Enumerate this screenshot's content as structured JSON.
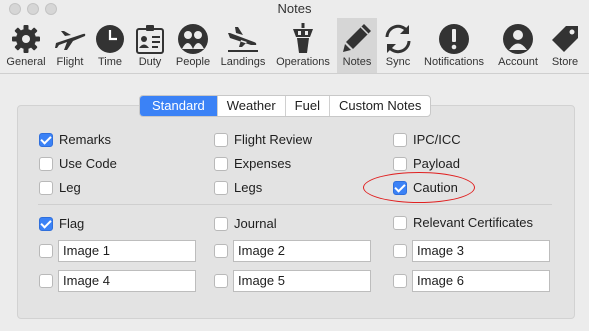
{
  "window": {
    "title": "Notes"
  },
  "toolbar": {
    "items": [
      {
        "label": "General",
        "icon": "gear-icon"
      },
      {
        "label": "Flight",
        "icon": "airplane-icon"
      },
      {
        "label": "Time",
        "icon": "clock-icon"
      },
      {
        "label": "Duty",
        "icon": "id-badge-icon"
      },
      {
        "label": "People",
        "icon": "people-icon"
      },
      {
        "label": "Landings",
        "icon": "landing-icon"
      },
      {
        "label": "Operations",
        "icon": "control-tower-icon"
      },
      {
        "label": "Notes",
        "icon": "pencil-icon",
        "selected": true
      },
      {
        "label": "Sync",
        "icon": "sync-icon"
      },
      {
        "label": "Notifications",
        "icon": "exclamation-icon"
      },
      {
        "label": "Account",
        "icon": "account-icon"
      },
      {
        "label": "Store",
        "icon": "tag-icon"
      }
    ]
  },
  "tabs": [
    {
      "label": "Standard",
      "active": true
    },
    {
      "label": "Weather"
    },
    {
      "label": "Fuel"
    },
    {
      "label": "Custom Notes"
    }
  ],
  "checkboxes": {
    "remarks": {
      "label": "Remarks",
      "checked": true
    },
    "use_code": {
      "label": "Use Code",
      "checked": false
    },
    "leg": {
      "label": "Leg",
      "checked": false
    },
    "flight_review": {
      "label": "Flight Review",
      "checked": false
    },
    "expenses": {
      "label": "Expenses",
      "checked": false
    },
    "legs": {
      "label": "Legs",
      "checked": false
    },
    "ipc_icc": {
      "label": "IPC/ICC",
      "checked": false
    },
    "payload": {
      "label": "Payload",
      "checked": false
    },
    "caution": {
      "label": "Caution",
      "checked": true
    },
    "flag": {
      "label": "Flag",
      "checked": true
    },
    "journal": {
      "label": "Journal",
      "checked": false
    },
    "relevant_certificates": {
      "label": "Relevant Certificates",
      "checked": false
    }
  },
  "images": [
    {
      "value": "Image 1",
      "checked": false
    },
    {
      "value": "Image 2",
      "checked": false
    },
    {
      "value": "Image 3",
      "checked": false
    },
    {
      "value": "Image 4",
      "checked": false
    },
    {
      "value": "Image 5",
      "checked": false
    },
    {
      "value": "Image 6",
      "checked": false
    }
  ],
  "colors": {
    "accent": "#3b82f6",
    "annotation": "#e02020",
    "selected_toolbar": "#d6d6d6"
  }
}
